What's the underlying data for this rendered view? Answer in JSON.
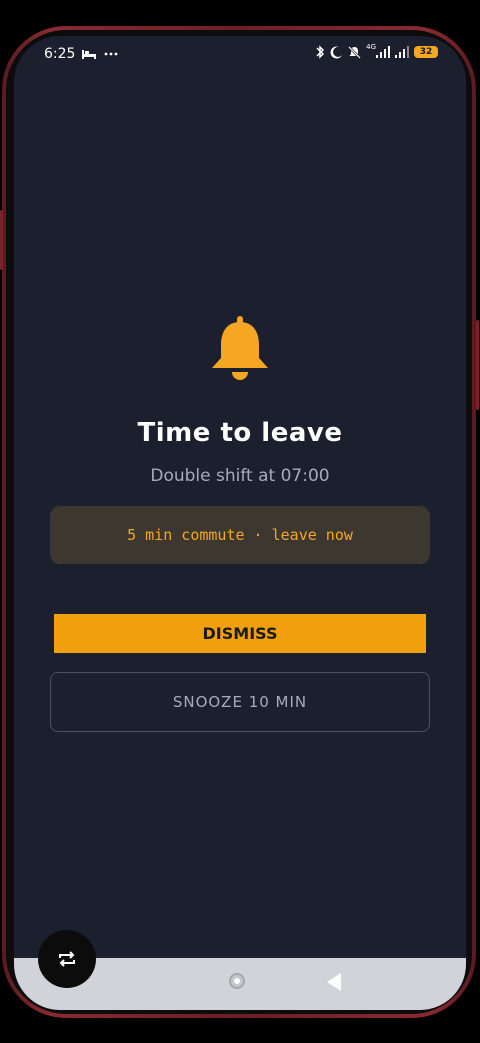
{
  "status_bar": {
    "time": "6:25",
    "left_icons": [
      "bed-icon",
      "more-dots-icon"
    ],
    "right_icons": [
      "bluetooth-icon",
      "moon-icon",
      "bell-off-icon",
      "4g-signal-icon",
      "signal-icon"
    ],
    "network_label": "4G",
    "battery_level": "32"
  },
  "alarm": {
    "icon": "bell-icon",
    "icon_color": "#f5a623",
    "title": "Time to leave",
    "subtitle": "Double shift at 07:00",
    "banner_text": "5 min commute · leave now"
  },
  "actions": {
    "dismiss_label": "DISMISS",
    "snooze_label": "SNOOZE 10 MIN"
  },
  "colors": {
    "background": "#1c1f2d",
    "accent": "#f29f0e",
    "banner_bg": "#3d382f",
    "nav_bar": "#d1d3d9"
  },
  "nav_bar": {
    "icons": [
      "home-button-icon",
      "back-triangle-icon"
    ]
  },
  "floating_button": {
    "icon": "repeat-icon"
  }
}
